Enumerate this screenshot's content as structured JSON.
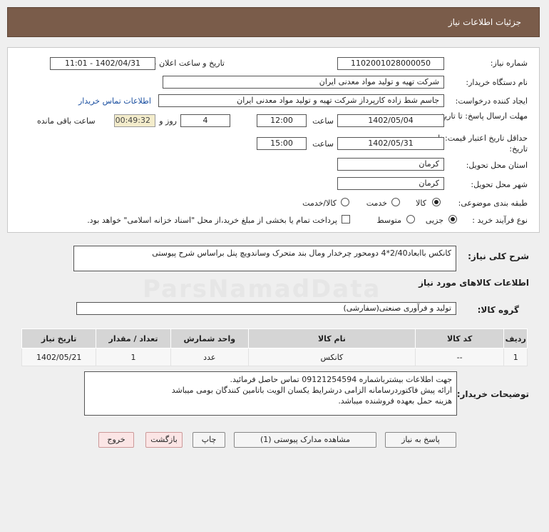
{
  "title": "جزئیات اطلاعات نیاز",
  "fields": {
    "need_number_label": "شماره نیاز:",
    "need_number": "1102001028000050",
    "announce_label": "تاریخ و ساعت اعلان عمومی:",
    "announce_value": "1402/04/31 - 11:01",
    "buyer_org_label": "نام دستگاه خریدار:",
    "buyer_org": "شرکت تهیه و تولید مواد معدنی ایران",
    "requester_label": "ایجاد کننده درخواست:",
    "requester": "جاسم شط زاده کارپرداز شرکت تهیه و تولید مواد معدنی ایران",
    "contact_link": "اطلاعات تماس خریدار",
    "deadline_label": "مهلت ارسال پاسخ: تا تاریخ:",
    "deadline_date": "1402/05/04",
    "time_label": "ساعت",
    "deadline_time": "12:00",
    "days_value": "4",
    "days_label": "روز و",
    "remaining_time": "00:49:32",
    "remaining_label": "ساعت باقی مانده",
    "validity_label": "حداقل تاریخ اعتبار قیمت: تا تاریخ:",
    "validity_date": "1402/05/31",
    "validity_time": "15:00",
    "province_label": "استان محل تحویل:",
    "province": "کرمان",
    "city_label": "شهر محل تحویل:",
    "city": "کرمان",
    "category_label": "طبقه بندی موضوعی:",
    "category_options": [
      "کالا",
      "خدمت",
      "کالا/خدمت"
    ],
    "process_label": "نوع فرآیند خرید :",
    "process_options": [
      "جزیی",
      "متوسط"
    ],
    "payment_note": "پرداخت تمام یا بخشی از مبلغ خرید،از محل \"اسناد خزانه اسلامی\" خواهد بود."
  },
  "summary": {
    "label": "شرح کلی نیاز:",
    "text": "کانکس باابعاد2/40*4 دومحور چرخدار ومال بند متحرک وساندویچ پنل براساس شرح پیوستی"
  },
  "goods_info_title": "اطلاعات کالاهای مورد نیاز",
  "goods_group": {
    "label": "گروه کالا:",
    "value": "تولید و فرآوری صنعتی(سفارشی)"
  },
  "table": {
    "headers": [
      "ردیف",
      "کد کالا",
      "نام کالا",
      "واحد شمارش",
      "تعداد / مقدار",
      "تاریخ نیاز"
    ],
    "rows": [
      [
        "1",
        "--",
        "کانکس",
        "عدد",
        "1",
        "1402/05/21"
      ]
    ]
  },
  "buyer_notes": {
    "label": "توضیحات خریدار:",
    "lines": [
      "جهت اطلاعات بیشترباشماره 09121254594 تماس حاصل فرمائید.",
      "ارائه پیش فاکتوردرسامانه الزامی درشرایط یکسان الویت باتامین کنندگان بومی میباشد",
      "هزینه حمل بعهده فروشنده میباشد."
    ]
  },
  "buttons": {
    "reply": "پاسخ به نیاز",
    "attachments": "مشاهده مدارک پیوستی (1)",
    "print": "چاپ",
    "back": "بازگشت",
    "exit": "خروج"
  },
  "watermark": "ParsNamadData"
}
